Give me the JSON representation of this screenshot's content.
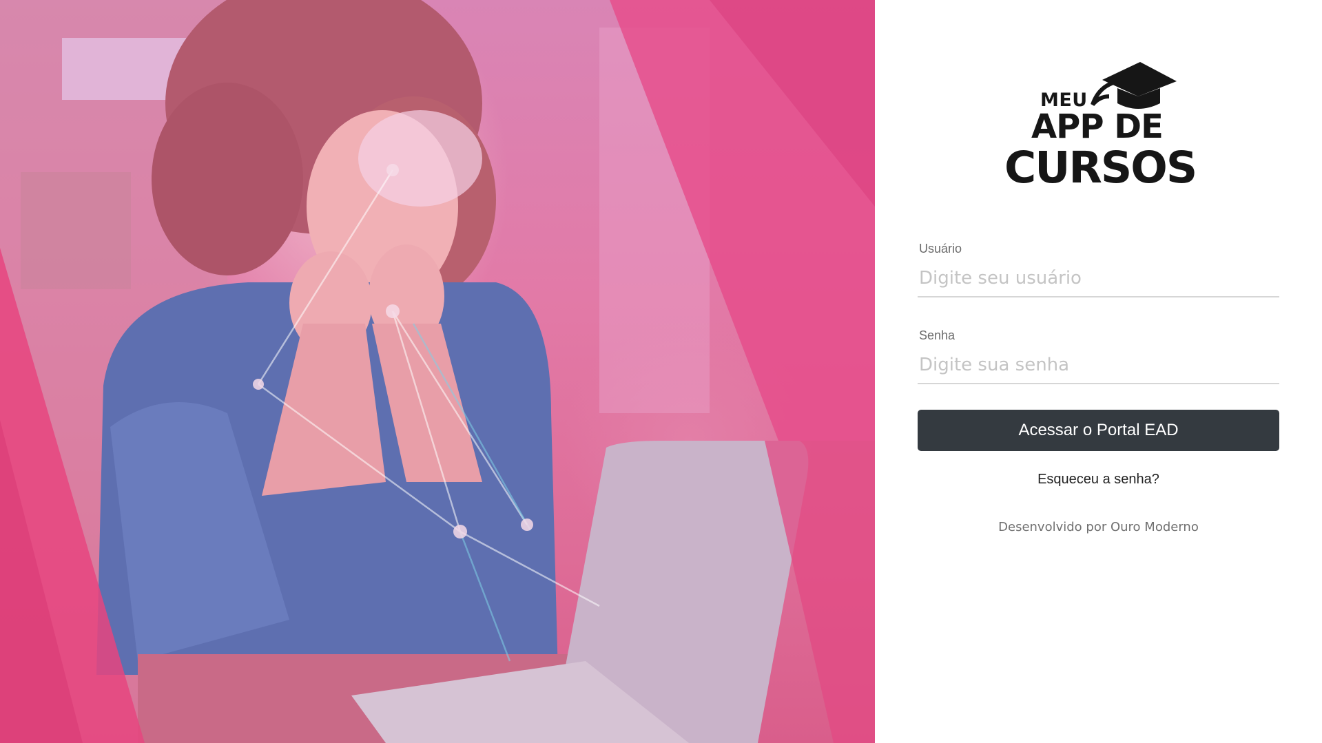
{
  "logo": {
    "line1": "MEU",
    "line2": "APP DE",
    "line3": "CURSOS"
  },
  "login": {
    "username_label": "Usuário",
    "username_placeholder": "Digite seu usuário",
    "password_label": "Senha",
    "password_placeholder": "Digite sua senha",
    "submit_label": "Acessar o Portal EAD",
    "forgot_label": "Esqueceu a senha?",
    "credit": "Desenvolvido por Ouro Moderno"
  },
  "colors": {
    "hero_pink": "#e05a8f",
    "button_bg": "#343a40",
    "panel_bg": "#ffffff"
  },
  "icons": {
    "logo_cap": "graduation-cap-icon"
  }
}
